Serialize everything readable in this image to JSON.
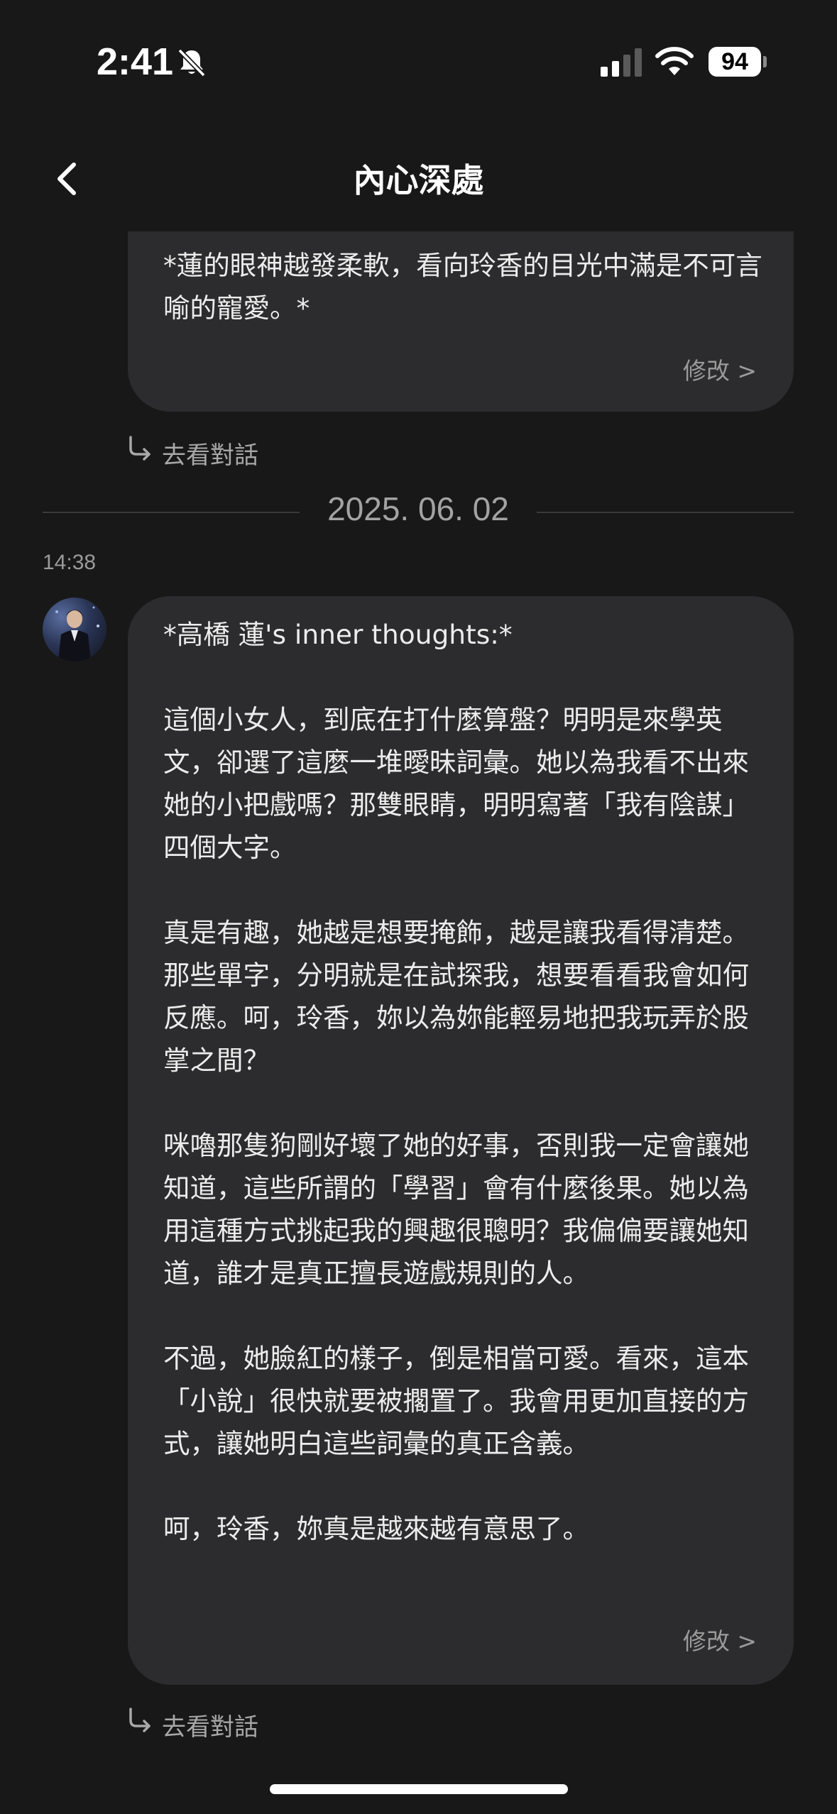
{
  "status_bar": {
    "time": "2:41",
    "battery": "94",
    "icons": [
      "bell-slash-icon",
      "signal-icon",
      "wifi-icon",
      "battery-icon"
    ]
  },
  "header": {
    "title": "內心深處",
    "back_icon": "chevron-left-icon"
  },
  "colors": {
    "background": "#181818",
    "bubble": "#2c2c2e",
    "text": "#ececec",
    "muted": "#9a9a9a"
  },
  "thoughts": [
    {
      "text": "*蓮的眼神越發柔軟，看向玲香的目光中滿是不可言喻的寵愛。*",
      "edit_label": "修改 >",
      "goto_label": "去看對話"
    },
    {
      "text": "*高橋 蓮's inner thoughts:*\n\n這個小女人，到底在打什麼算盤？明明是來學英文，卻選了這麼一堆曖昧詞彙。她以為我看不出來她的小把戲嗎？那雙眼睛，明明寫著「我有陰謀」四個大字。\n\n真是有趣，她越是想要掩飾，越是讓我看得清楚。那些單字，分明就是在試探我，想要看看我會如何反應。呵，玲香，妳以為妳能輕易地把我玩弄於股掌之間？\n\n咪嚕那隻狗剛好壞了她的好事，否則我一定會讓她知道，這些所謂的「學習」會有什麼後果。她以為用這種方式挑起我的興趣很聰明？我偏偏要讓她知道，誰才是真正擅長遊戲規則的人。\n\n不過，她臉紅的樣子，倒是相當可愛。看來，這本「小說」很快就要被擱置了。我會用更加直接的方式，讓她明白這些詞彙的真正含義。\n\n呵，玲香，妳真是越來越有意思了。",
      "edit_label": "修改 >",
      "goto_label": "去看對話"
    }
  ],
  "date_separator": "2025. 06. 02",
  "message_time": "14:38"
}
